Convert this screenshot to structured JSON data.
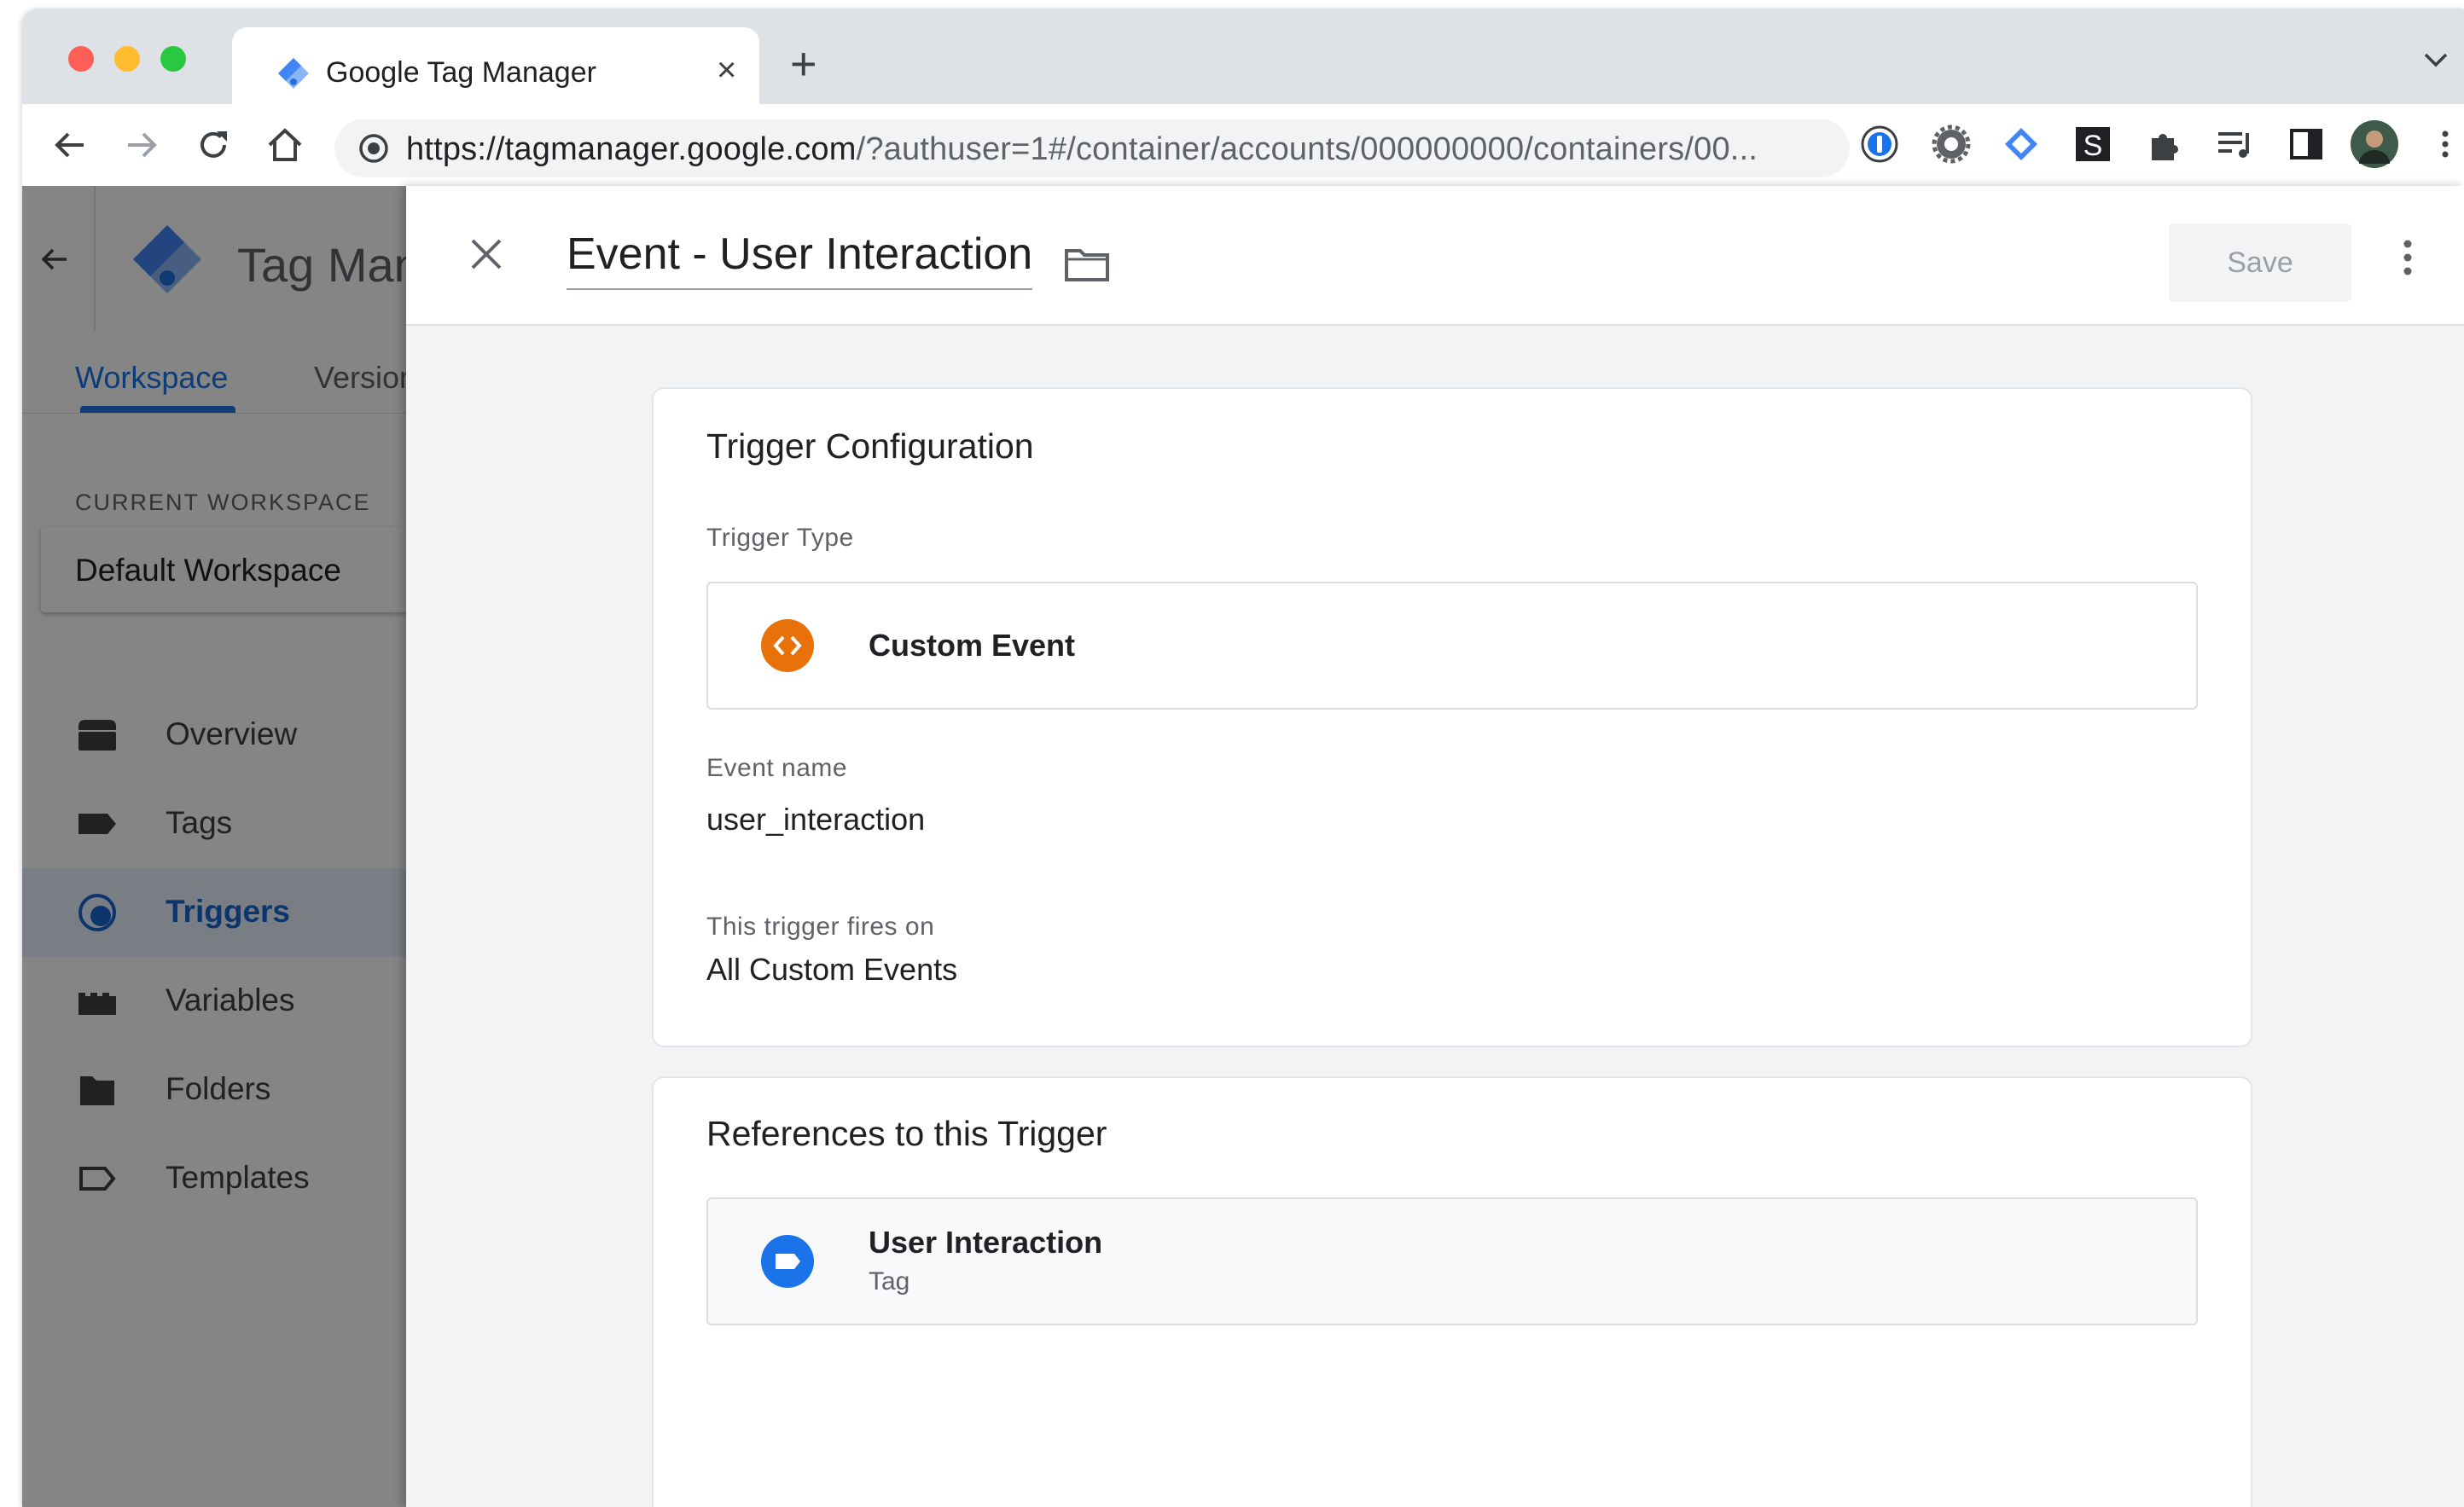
{
  "browser": {
    "tab_title": "Google Tag Manager",
    "tab_close": "×",
    "new_tab": "+",
    "url_host": "https://tagmanager.google.com",
    "url_path": "/?authuser=1#/container/accounts/000000000/containers/00..."
  },
  "sidebar": {
    "product_name": "Tag Manager",
    "tabs": {
      "workspace": "Workspace",
      "versions": "Versions"
    },
    "current_workspace_label": "CURRENT WORKSPACE",
    "workspace_name": "Default Workspace",
    "items": [
      {
        "label": "Overview",
        "icon": "overview-icon"
      },
      {
        "label": "Tags",
        "icon": "tag-icon"
      },
      {
        "label": "Triggers",
        "icon": "trigger-icon",
        "active": true
      },
      {
        "label": "Variables",
        "icon": "variable-icon"
      },
      {
        "label": "Folders",
        "icon": "folder-icon"
      },
      {
        "label": "Templates",
        "icon": "template-icon"
      }
    ]
  },
  "panel": {
    "title": "Event - User Interaction",
    "save_label": "Save",
    "config_card": {
      "title": "Trigger Configuration",
      "trigger_type_label": "Trigger Type",
      "trigger_type_value": "Custom Event",
      "event_name_label": "Event name",
      "event_name_value": "user_interaction",
      "fires_on_label": "This trigger fires on",
      "fires_on_value": "All Custom Events"
    },
    "references_card": {
      "title": "References to this Trigger",
      "item_name": "User Interaction",
      "item_type": "Tag"
    }
  },
  "colors": {
    "accent": "#1a73e8",
    "custom_event_icon": "#e8710a",
    "tag_icon": "#1a73e8"
  }
}
